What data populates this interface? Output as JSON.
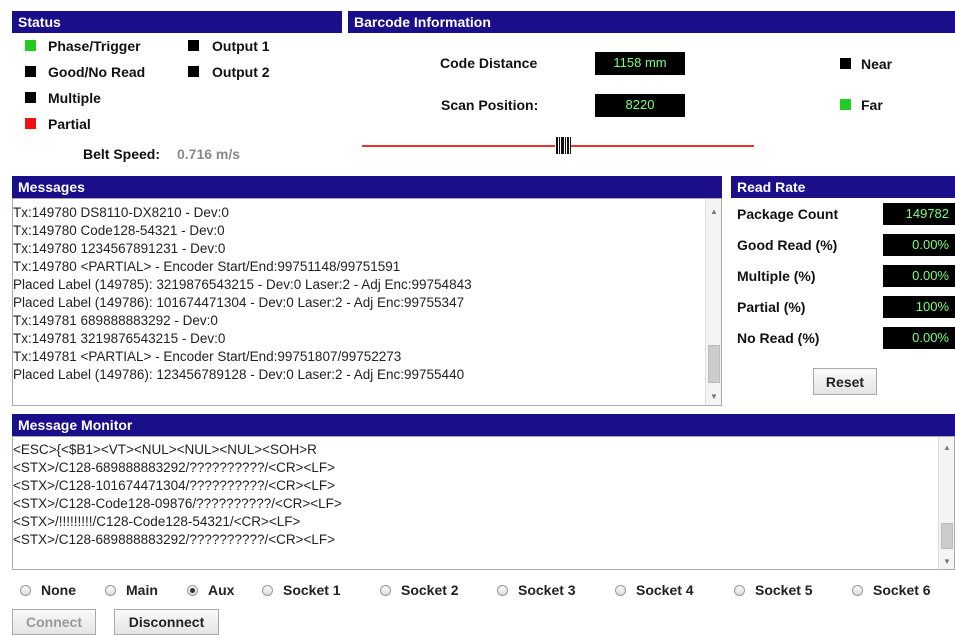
{
  "status": {
    "header": "Status",
    "indicators": [
      {
        "label": "Phase/Trigger",
        "color": "#22cc22"
      },
      {
        "label": "Good/No Read",
        "color": "#000000"
      },
      {
        "label": "Multiple",
        "color": "#000000"
      },
      {
        "label": "Partial",
        "color": "#ee1111"
      },
      {
        "label": "Output 1",
        "color": "#000000"
      },
      {
        "label": "Output 2",
        "color": "#000000"
      }
    ],
    "belt_speed_label": "Belt Speed:",
    "belt_speed_value": "0.716 m/s"
  },
  "barcode": {
    "header": "Barcode Information",
    "code_distance_label": "Code Distance",
    "code_distance_value": "1158 mm",
    "scan_position_label": "Scan Position:",
    "scan_position_value": "8220",
    "near_label": "Near",
    "near_color": "#000000",
    "far_label": "Far",
    "far_color": "#22cc22"
  },
  "messages": {
    "header": "Messages",
    "lines": [
      "Tx:149780 DS8110-DX8210 - Dev:0",
      "Tx:149780 Code128-54321 - Dev:0",
      "Tx:149780 1234567891231 - Dev:0",
      "Tx:149780 <PARTIAL> - Encoder Start/End:99751148/99751591",
      "Placed Label (149785): 3219876543215 - Dev:0 Laser:2 - Adj Enc:99754843",
      "Placed Label (149786): 101674471304 - Dev:0 Laser:2 - Adj Enc:99755347",
      "Tx:149781 689888883292 - Dev:0",
      "Tx:149781 3219876543215 - Dev:0",
      "Tx:149781 <PARTIAL> - Encoder Start/End:99751807/99752273",
      "Placed Label (149786): 123456789128 - Dev:0 Laser:2 - Adj Enc:99755440"
    ]
  },
  "read_rate": {
    "header": "Read Rate",
    "rows": [
      {
        "label": "Package Count",
        "value": "149782"
      },
      {
        "label": "Good Read (%)",
        "value": "0.00%"
      },
      {
        "label": "Multiple (%)",
        "value": "0.00%"
      },
      {
        "label": "Partial (%)",
        "value": "100%"
      },
      {
        "label": "No Read (%)",
        "value": "0.00%"
      }
    ],
    "reset_label": "Reset"
  },
  "monitor": {
    "header": "Message Monitor",
    "lines": [
      "<ESC>{<$B1><VT><NUL><NUL><NUL><SOH>R",
      "<STX>/C128-689888883292/??????????/<CR><LF>",
      "<STX>/C128-101674471304/??????????/<CR><LF>",
      "<STX>/C128-Code128-09876/??????????/<CR><LF>",
      "<STX>/!!!!!!!!!/C128-Code128-54321/<CR><LF>",
      "<STX>/C128-689888883292/??????????/<CR><LF>"
    ]
  },
  "source": {
    "options": [
      "None",
      "Main",
      "Aux",
      "Socket 1",
      "Socket 2",
      "Socket 3",
      "Socket 4",
      "Socket 5",
      "Socket 6"
    ],
    "selected": "Aux"
  },
  "buttons": {
    "connect_label": "Connect",
    "disconnect_label": "Disconnect"
  }
}
